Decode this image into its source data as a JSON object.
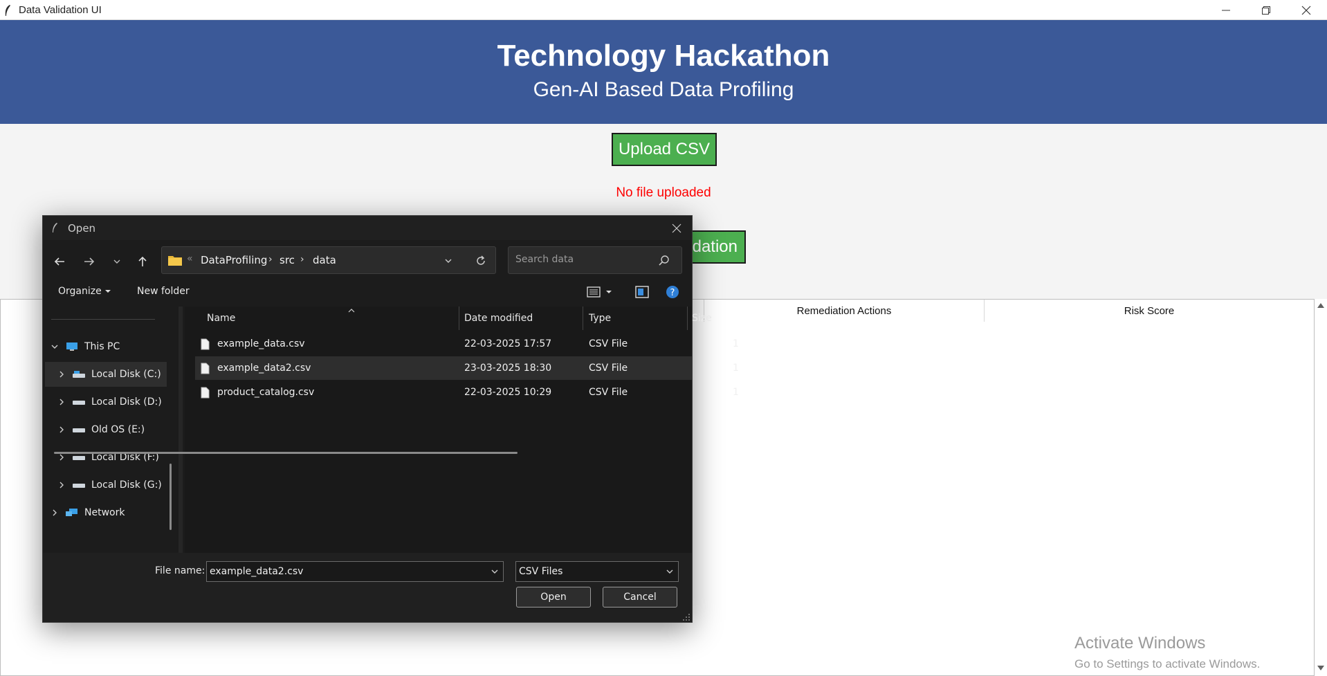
{
  "window": {
    "title": "Data Validation UI"
  },
  "header": {
    "title": "Technology Hackathon",
    "subtitle": "Gen-AI Based Data Profiling"
  },
  "main": {
    "upload_label": "Upload CSV",
    "status_text": "No file uploaded",
    "validate_label_visible": "idation",
    "table_headers": [
      "Remediation Actions",
      "Risk Score"
    ]
  },
  "watermark": {
    "line1": "Activate Windows",
    "line2": "Go to Settings to activate Windows."
  },
  "dialog": {
    "title": "Open",
    "breadcrumb": [
      "DataProfiling",
      "src",
      "data"
    ],
    "search_placeholder": "Search data",
    "commands": {
      "organize": "Organize",
      "new_folder": "New folder"
    },
    "nav": [
      {
        "label": "This PC",
        "icon": "computer-icon"
      },
      {
        "label": "Local Disk (C:)",
        "icon": "drive-icon"
      },
      {
        "label": "Local Disk (D:)",
        "icon": "drive-icon"
      },
      {
        "label": "Old OS (E:)",
        "icon": "drive-icon"
      },
      {
        "label": "Local Disk (F:)",
        "icon": "drive-icon"
      },
      {
        "label": "Local Disk (G:)",
        "icon": "drive-icon"
      },
      {
        "label": "Network",
        "icon": "network-icon"
      }
    ],
    "columns": [
      "Name",
      "Date modified",
      "Type",
      "Size"
    ],
    "files": [
      {
        "name": "example_data.csv",
        "modified": "22-03-2025 17:57",
        "type": "CSV File",
        "size": "1"
      },
      {
        "name": "example_data2.csv",
        "modified": "23-03-2025 18:30",
        "type": "CSV File",
        "size": "1"
      },
      {
        "name": "product_catalog.csv",
        "modified": "22-03-2025 10:29",
        "type": "CSV File",
        "size": "1"
      }
    ],
    "file_name_label": "File name:",
    "file_name_value": "example_data2.csv",
    "file_type_value": "CSV Files",
    "open_label": "Open",
    "cancel_label": "Cancel"
  },
  "colors": {
    "header_bg": "#3b5998",
    "button_green": "#4caf50",
    "status_red": "#ff0000",
    "dialog_bg": "#1c1c1c"
  }
}
